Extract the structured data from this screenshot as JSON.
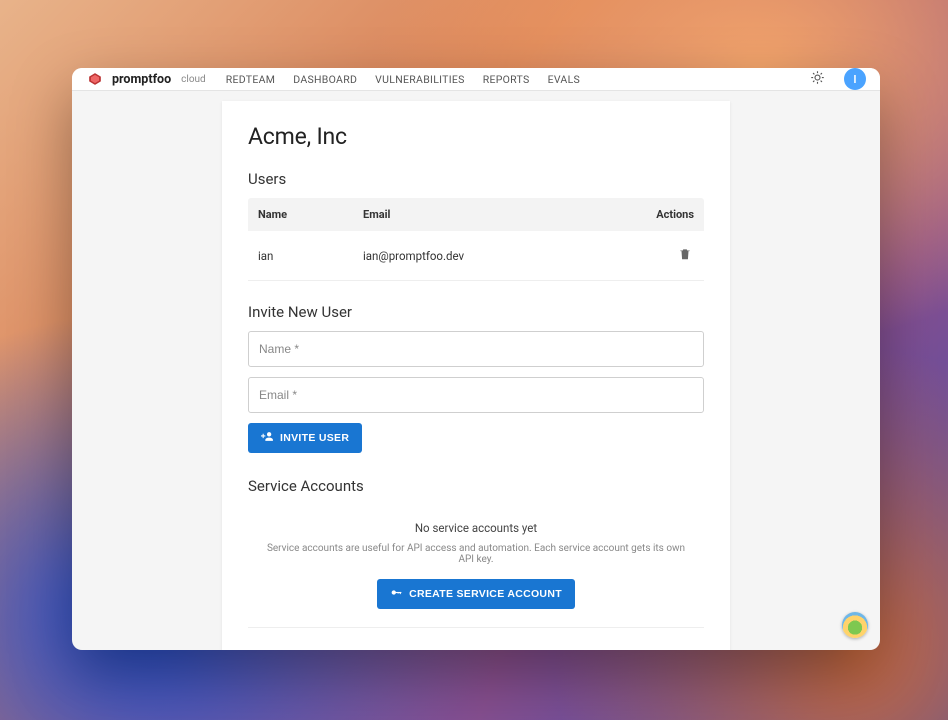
{
  "brand": {
    "name": "promptfoo",
    "tier": "cloud"
  },
  "nav": {
    "items": [
      {
        "label": "REDTEAM"
      },
      {
        "label": "DASHBOARD"
      },
      {
        "label": "VULNERABILITIES"
      },
      {
        "label": "REPORTS"
      },
      {
        "label": "EVALS"
      }
    ]
  },
  "avatar": {
    "initial": "I"
  },
  "org": {
    "title": "Acme, Inc"
  },
  "users": {
    "heading": "Users",
    "columns": {
      "name": "Name",
      "email": "Email",
      "actions": "Actions"
    },
    "rows": [
      {
        "name": "ian",
        "email": "ian@promptfoo.dev"
      }
    ]
  },
  "invite": {
    "heading": "Invite New User",
    "name_placeholder": "Name *",
    "email_placeholder": "Email *",
    "button_label": "INVITE USER"
  },
  "service_accounts": {
    "heading": "Service Accounts",
    "empty_title": "No service accounts yet",
    "empty_subtitle": "Service accounts are useful for API access and automation. Each service account gets its own API key.",
    "create_button_label": "CREATE SERVICE ACCOUNT"
  }
}
